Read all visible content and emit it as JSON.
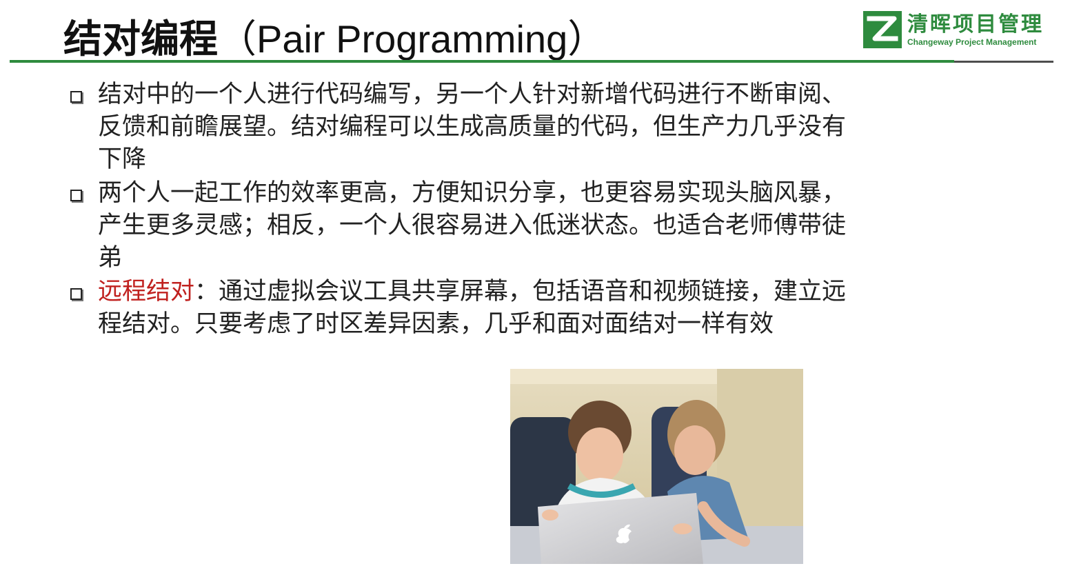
{
  "slide": {
    "title_cn": "结对编程",
    "title_en": "（Pair Programming）",
    "logo": {
      "name_cn": "清晖项目管理",
      "name_en": "Changeway Project Management",
      "color": "#2e8b3e"
    },
    "accent_color": "#c0211f",
    "bullets": [
      {
        "text": "结对中的一个人进行代码编写，另一个人针对新增代码进行不断审阅、反馈和前瞻展望。结对编程可以生成高质量的代码，但生产力几乎没有下降"
      },
      {
        "text": "两个人一起工作的效率更高，方便知识分享，也更容易实现头脑风暴，产生更多灵感；相反，一个人很容易进入低迷状态。也适合老师傅带徒弟"
      },
      {
        "highlight": "远程结对",
        "text": "：通过虚拟会议工具共享屏幕，包括语音和视频链接，建立远程结对。只要考虑了时区差异因素，几乎和面对面结对一样有效"
      }
    ],
    "photo": {
      "icon": "apple-logo-icon"
    }
  }
}
